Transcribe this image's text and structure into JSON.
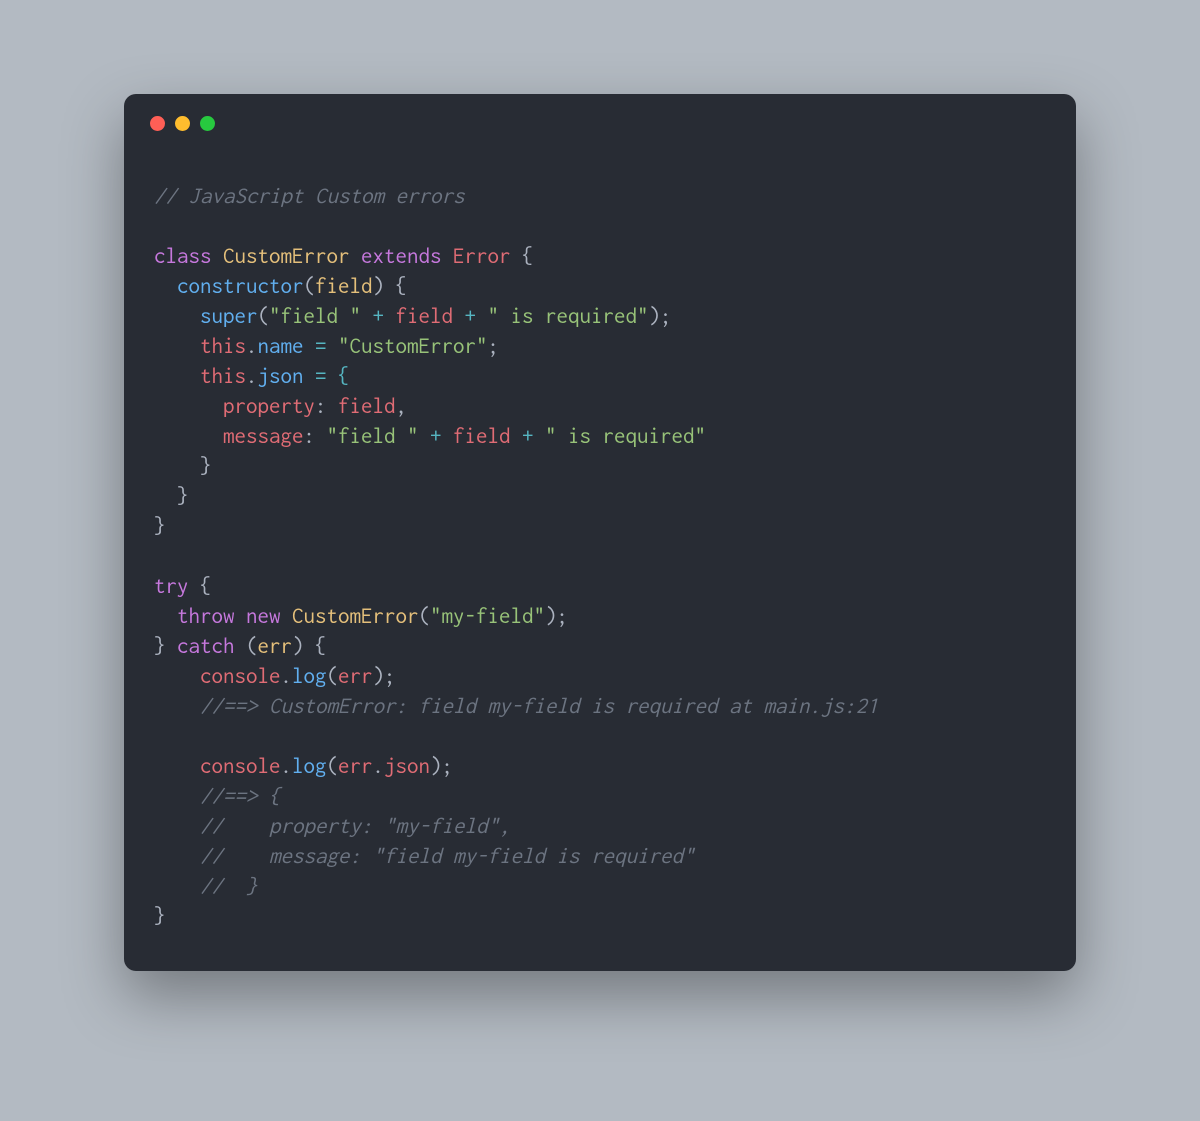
{
  "code": {
    "c1": "// JavaScript Custom errors",
    "kw_class": "class",
    "cls_custom": "CustomError",
    "kw_extends": "extends",
    "cls_error": "Error",
    "brace_open": " {",
    "fn_constructor": "constructor",
    "paren_open": "(",
    "param_field": "field",
    "paren_close_brace": ") {",
    "fn_super": "super",
    "str_field_sp": "\"field \"",
    "op_plus": " + ",
    "str_is_req": "\" is required\"",
    "paren_close_semi": ");",
    "kw_this": "this",
    "dot": ".",
    "prop_name": "name",
    "op_eq": " = ",
    "str_customerr": "\"CustomError\"",
    "semi": ";",
    "prop_json": "json",
    "eq_brace": " = {",
    "prop_property": "property",
    "colon_sp": ": ",
    "comma": ",",
    "prop_message": "message",
    "brace_close": "}",
    "kw_try": "try",
    "sp_brace": " {",
    "kw_throw": "throw",
    "kw_new": "new",
    "str_myfield": "\"my-field\"",
    "brace_close_sp": "} ",
    "kw_catch": "catch",
    "sp_paren": " (",
    "param_err": "err",
    "obj_console": "console",
    "fn_log": "log",
    "c2": "//==> CustomError: field my-field is required at main.js:21",
    "c3": "//==> {",
    "c4": "//    property: \"my-field\",",
    "c5": "//    message: \"field my-field is required\"",
    "c6": "//  }",
    "paren_close": ")"
  }
}
